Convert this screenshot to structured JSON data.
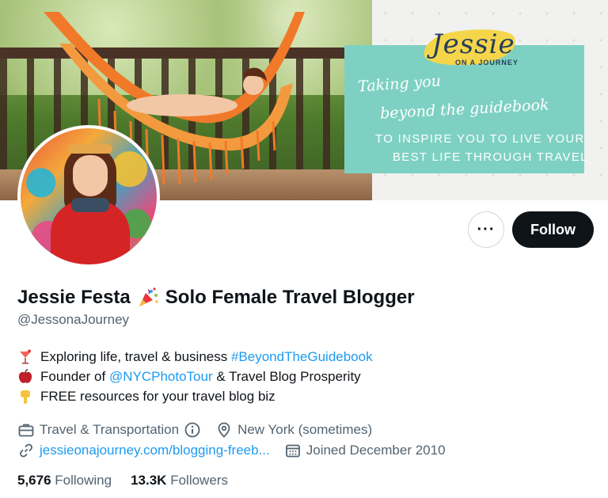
{
  "banner": {
    "logo": {
      "title": "Jessie",
      "subtitle": "ON A JOURNEY"
    },
    "tagline_script_1": "Taking you",
    "tagline_script_2": "beyond the guidebook",
    "tagline_caps_1": "TO INSPIRE YOU TO LIVE YOUR",
    "tagline_caps_2": "BEST LIFE THROUGH TRAVEL"
  },
  "actions": {
    "more_label": "···",
    "follow_label": "Follow"
  },
  "profile": {
    "name": "Jessie Festa",
    "name_suffix": "Solo Female Travel Blogger",
    "handle": "@JessonaJourney",
    "bio": [
      {
        "icon": "cocktail-icon",
        "text": "Exploring life, travel & business ",
        "link": "#BeyondTheGuidebook"
      },
      {
        "icon": "apple-icon",
        "text": "Founder of ",
        "link": "@NYCPhotoTour",
        "after": " & Travel Blog Prosperity"
      },
      {
        "icon": "pointing-down-icon",
        "text": "FREE resources for your travel blog biz"
      }
    ],
    "category": "Travel & Transportation",
    "location": "New York (sometimes)",
    "website": "jessieonajourney.com/blogging-freeb...",
    "joined": "Joined December 2010"
  },
  "stats": {
    "following_count": "5,676",
    "following_label": "Following",
    "followers_count": "13.3K",
    "followers_label": "Followers"
  },
  "colors": {
    "accent": "#1d9bf0",
    "text": "#0f1419",
    "muted": "#536471",
    "promo_teal": "#7ed1c2",
    "hammock_orange": "#f07a2a"
  }
}
